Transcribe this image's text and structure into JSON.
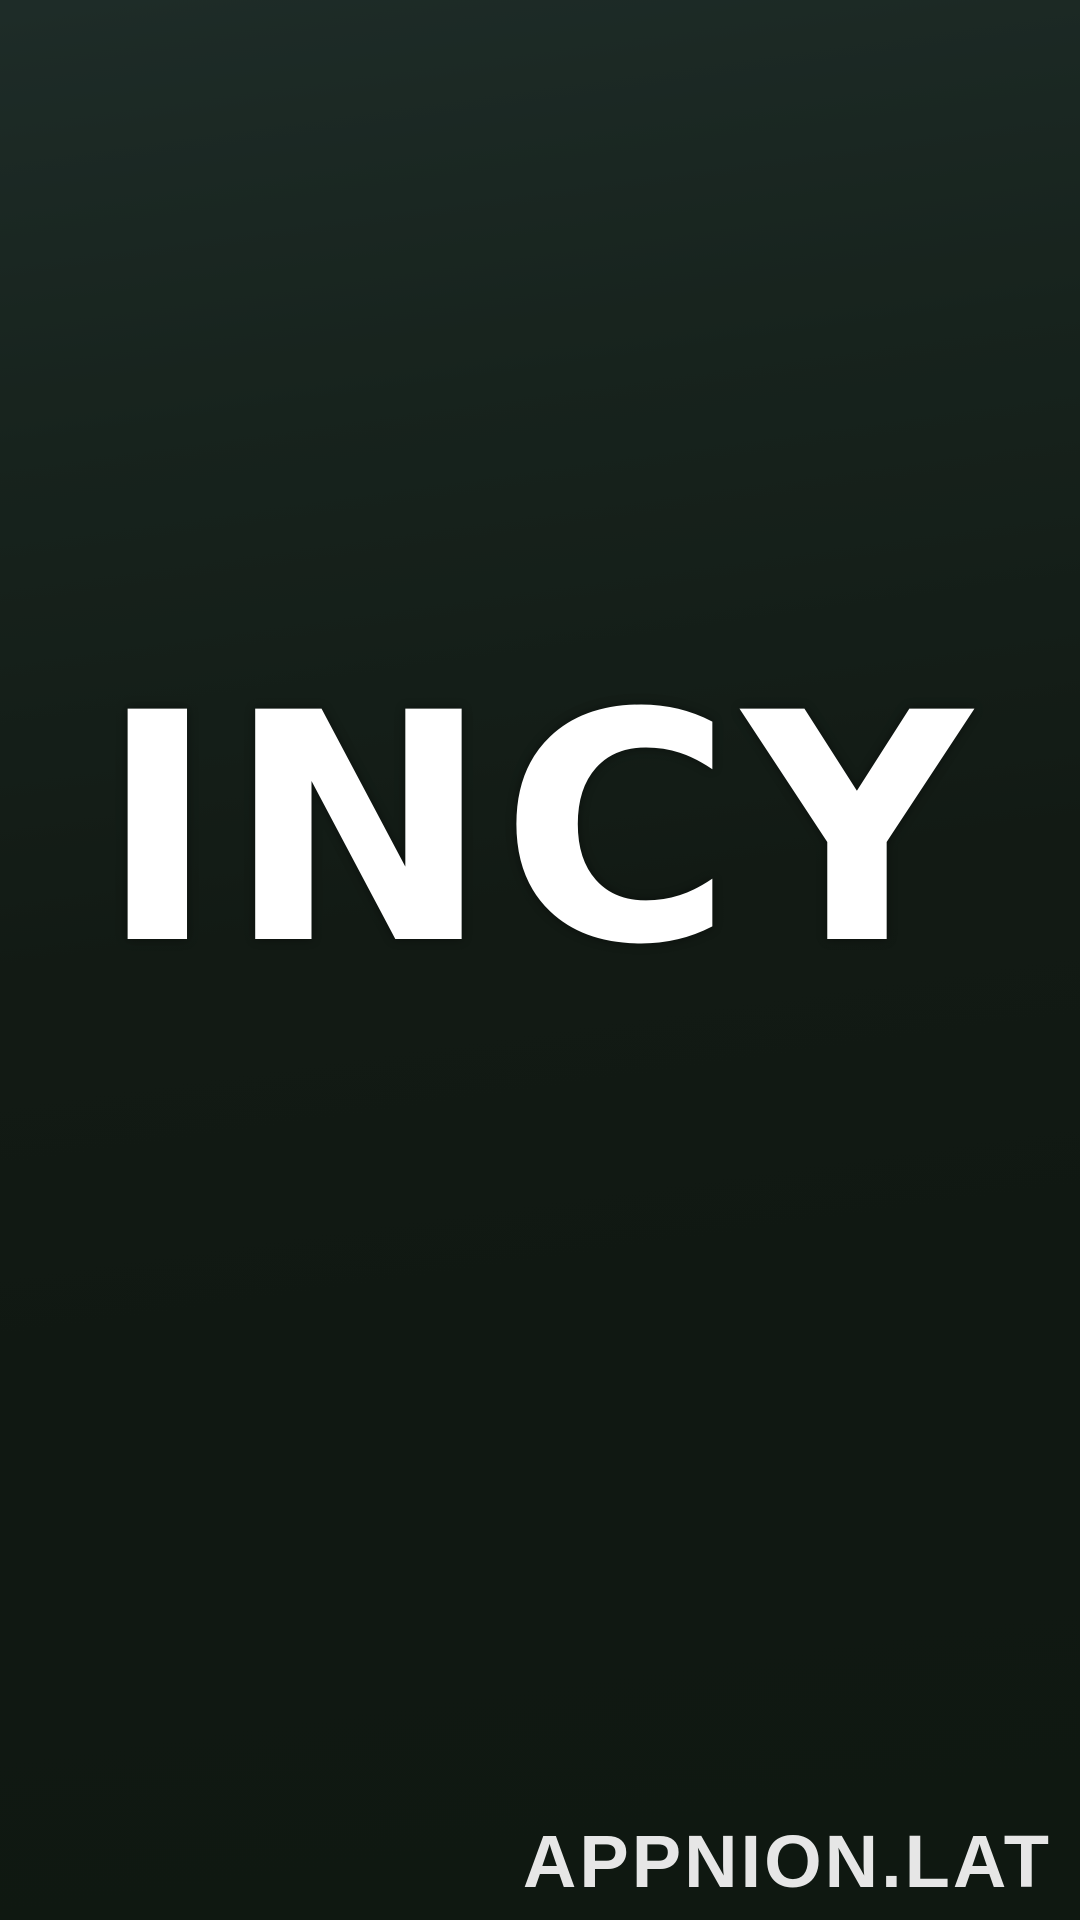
{
  "app": {
    "logo_text": "INCY"
  },
  "watermark": {
    "text": "APPNION.LAT"
  }
}
